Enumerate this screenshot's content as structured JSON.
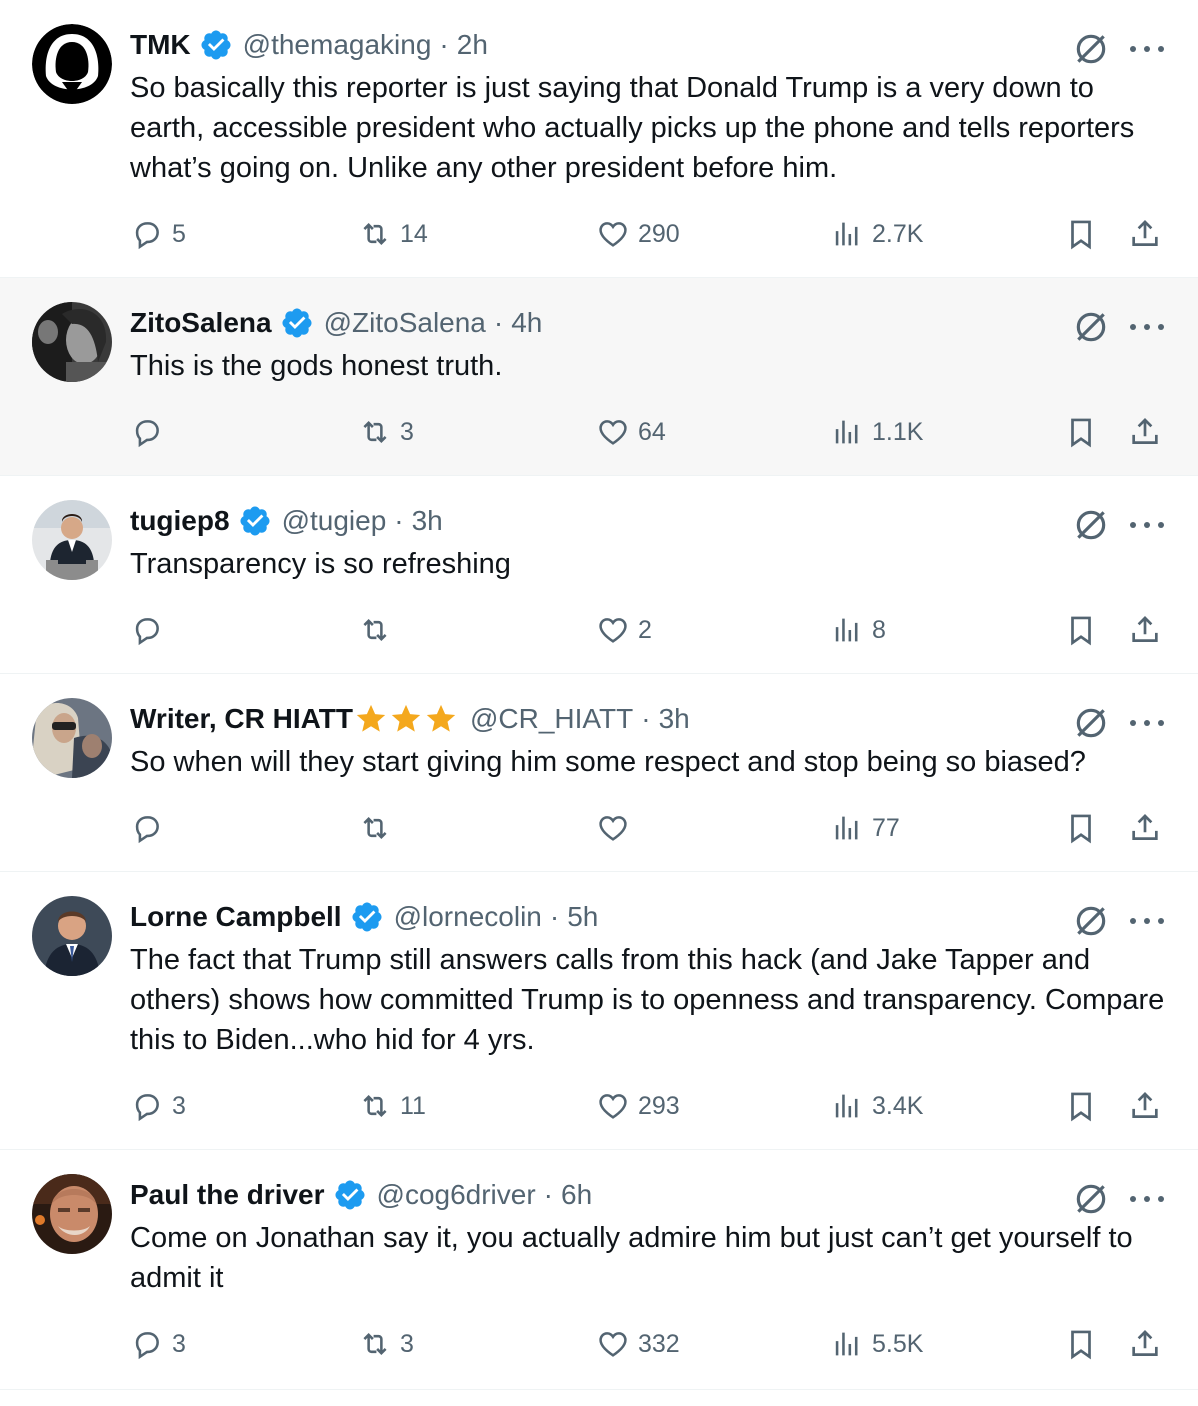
{
  "colors": {
    "verified": "#1d9bf0",
    "star": "#f4a81d",
    "muted": "#536471",
    "text": "#0f1419"
  },
  "tweets": [
    {
      "name": "TMK",
      "handle": "@themagaking",
      "sep": "·",
      "time": "2h",
      "text": "So basically this reporter is just saying that Donald Trump is a very down to earth, accessible president who actually picks up the phone and tells reporters what’s going on. Unlike any other president before him.",
      "replies": "5",
      "reposts": "14",
      "likes": "290",
      "views": "2.7K"
    },
    {
      "name": "ZitoSalena",
      "handle": "@ZitoSalena",
      "sep": "·",
      "time": "4h",
      "text": "This is the gods honest truth.",
      "replies": "",
      "reposts": "3",
      "likes": "64",
      "views": "1.1K"
    },
    {
      "name": "tugiep8",
      "handle": "@tugiep",
      "sep": "·",
      "time": "3h",
      "text": "Transparency is so refreshing",
      "replies": "",
      "reposts": "",
      "likes": "2",
      "views": "8"
    },
    {
      "name": "Writer, CR HIATT",
      "handle": "@CR_HIATT",
      "sep": "·",
      "time": "3h",
      "text": "So when will they start giving him some respect and stop being so biased?",
      "replies": "",
      "reposts": "",
      "likes": "",
      "views": "77"
    },
    {
      "name": "Lorne Campbell",
      "handle": "@lornecolin",
      "sep": "·",
      "time": "5h",
      "text": "The fact that Trump still answers calls from this hack (and Jake Tapper and others) shows how committed Trump is to openness and transparency. Compare this to Biden...who hid for 4 yrs.",
      "replies": "3",
      "reposts": "11",
      "likes": "293",
      "views": "3.4K"
    },
    {
      "name": "Paul the driver",
      "handle": "@cog6driver",
      "sep": "·",
      "time": "6h",
      "text": "Come on Jonathan say it, you actually admire him but just can’t get yourself to admit it",
      "replies": "3",
      "reposts": "3",
      "likes": "332",
      "views": "5.5K"
    }
  ]
}
